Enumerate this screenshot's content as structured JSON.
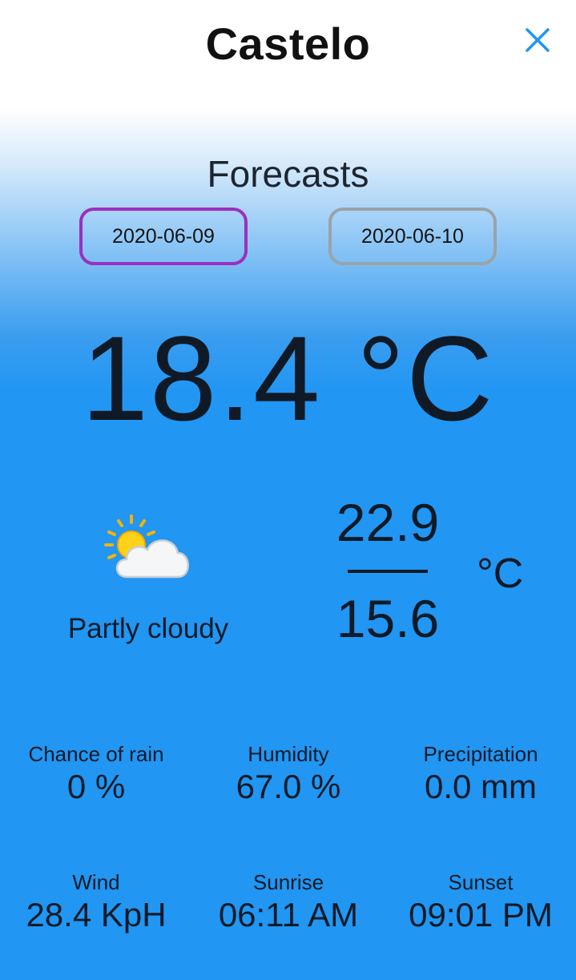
{
  "header": {
    "title": "Castelo",
    "close_icon": "close-icon"
  },
  "forecasts": {
    "title": "Forecasts",
    "dates": [
      {
        "label": "2020-06-09",
        "selected": true
      },
      {
        "label": "2020-06-10",
        "selected": false
      }
    ]
  },
  "current": {
    "temperature": "18.4 °C",
    "condition": "Partly cloudy",
    "icon": "partly-cloudy-icon",
    "max": "22.9",
    "min": "15.6",
    "unit": "°C"
  },
  "stats": [
    {
      "label": "Chance of rain",
      "value": "0 %"
    },
    {
      "label": "Humidity",
      "value": "67.0 %"
    },
    {
      "label": "Precipitation",
      "value": "0.0 mm"
    },
    {
      "label": "Wind",
      "value": "28.4 KpH"
    },
    {
      "label": "Sunrise",
      "value": "06:11 AM"
    },
    {
      "label": "Sunset",
      "value": "09:01 PM"
    }
  ],
  "colors": {
    "accent": "#2196f3",
    "selected_border": "#9c2fbf",
    "unselected_border": "#9aa3a8",
    "close_icon": "#2196f3"
  }
}
